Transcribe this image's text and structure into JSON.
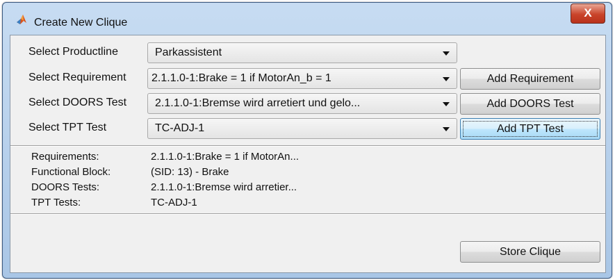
{
  "window": {
    "title": "Create New Clique",
    "close_label": "X"
  },
  "form": {
    "productline_label": "Select Productline",
    "productline_value": "Parkassistent",
    "requirement_label": "Select Requirement",
    "requirement_value": "2.1.1.0-1:Brake = 1 if MotorAn_b = 1",
    "doors_label": "Select DOORS Test",
    "doors_value": "2.1.1.0-1:Bremse wird arretiert und gelo...",
    "tpt_label": "Select TPT Test",
    "tpt_value": "TC-ADJ-1"
  },
  "buttons": {
    "add_requirement": "Add Requirement",
    "add_doors": "Add DOORS Test",
    "add_tpt": "Add TPT Test",
    "store": "Store Clique"
  },
  "summary": {
    "requirements_label": "Requirements:",
    "requirements_value": "2.1.1.0-1:Brake = 1 if MotorAn...",
    "functional_label": "Functional Block:",
    "functional_value": "(SID: 13) - Brake",
    "doors_label": "DOORS Tests:",
    "doors_value": "2.1.1.0-1:Bremse wird arretier...",
    "tpt_label": "TPT Tests:",
    "tpt_value": "TC-ADJ-1"
  },
  "icons": {
    "app": "matlab-icon",
    "close": "close-icon",
    "dropdown": "chevron-down-icon"
  },
  "colors": {
    "title_bar": "#bcd4ee",
    "close_button": "#c9442a",
    "client_bg": "#f0f0f0",
    "focus_button": "#bee6fd"
  }
}
